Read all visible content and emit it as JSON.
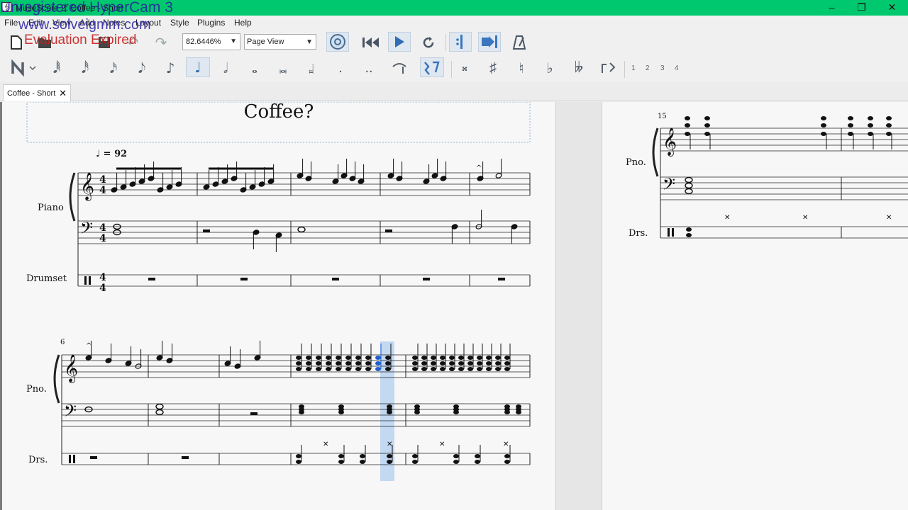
{
  "titlebar": {
    "title": "MuseScore 2: Coffee - Short",
    "app_icon": "musescore-app-icon",
    "watermark_line1": "Unregistered HyperCam 3",
    "watermark_line2": "www.solveigmm.com",
    "watermark_line3": "Evaluation Expired",
    "minimize": "–",
    "restore": "❐",
    "close": "✕"
  },
  "menu": [
    "File",
    "Edit",
    "View",
    "Add",
    "Notes",
    "Layout",
    "Style",
    "Plugins",
    "Help"
  ],
  "toolbar": {
    "zoom_value": "82.6446%",
    "view_mode": "Page View",
    "voices": [
      "1",
      "2",
      "3",
      "4"
    ]
  },
  "tab": {
    "label": "Coffee - Short",
    "close": "✕"
  },
  "score": {
    "title": "Coffee?",
    "tempo_text": "♩ = 92",
    "instruments_full": {
      "piano": "Piano",
      "drums": "Drumset"
    },
    "instruments_short": {
      "piano": "Pno.",
      "drums": "Drs."
    },
    "time_signature": "4/4",
    "measure_number_system2": "6",
    "measure_number_page2": "15"
  },
  "colors": {
    "titlebar": "#00c86e",
    "selection": "#b5d0ef",
    "selected_note": "#1f5fd0",
    "canvas_gap": "#7c7c7c"
  }
}
